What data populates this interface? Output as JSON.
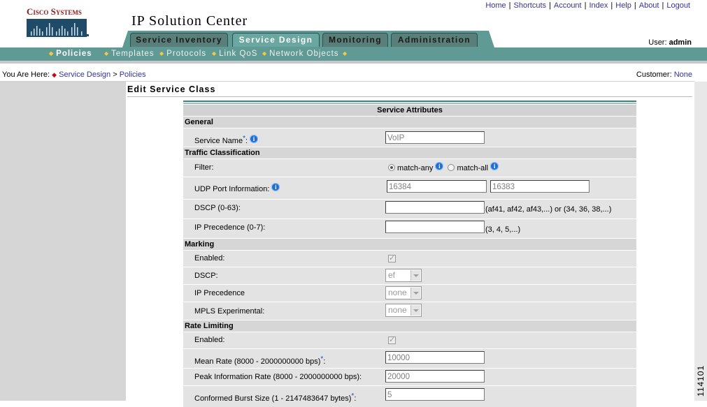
{
  "brand": {
    "logo_text": "Cisco Systems",
    "app_title": "IP Solution Center"
  },
  "top_links": [
    "Home",
    "Shortcuts",
    "Account",
    "Index",
    "Help",
    "About",
    "Logout"
  ],
  "user": {
    "label": "User:",
    "name": "admin"
  },
  "tabs": [
    {
      "label": "Service Inventory",
      "active": false
    },
    {
      "label": "Service Design",
      "active": true
    },
    {
      "label": "Monitoring",
      "active": false
    },
    {
      "label": "Administration",
      "active": false
    }
  ],
  "subnav": [
    "Policies",
    "Templates",
    "Protocols",
    "Link QoS",
    "Network Objects"
  ],
  "breadcrumb": {
    "prefix": "You Are Here:",
    "items": [
      "Service Design",
      "Policies"
    ]
  },
  "customer": {
    "label": "Customer:",
    "value": "None"
  },
  "page_title": "Edit Service Class",
  "form": {
    "title": "Service Attributes",
    "sections": {
      "general": "General",
      "traffic": "Traffic Classification",
      "marking": "Marking",
      "rate": "Rate Limiting"
    },
    "service_name": {
      "label": "Service Name",
      "value": "VoIP"
    },
    "filter": {
      "label": "Filter:",
      "option_any": "match-any",
      "option_all": "match-all",
      "selected": "match-any"
    },
    "udp": {
      "label": "UDP Port Information:",
      "value1": "16384",
      "value2": "16383"
    },
    "dscp": {
      "label": "DSCP (0-63):",
      "value": "",
      "hint": "(af41, af42, af43,...) or (34, 36, 38,...)"
    },
    "ip_prec": {
      "label": "IP Precedence (0-7):",
      "value": "",
      "hint": "(3, 4, 5,...)"
    },
    "marking_enabled": {
      "label": "Enabled:",
      "checked": true
    },
    "marking_dscp": {
      "label": "DSCP:",
      "value": "ef"
    },
    "marking_ip_prec": {
      "label": "IP Precedence",
      "value": "none"
    },
    "marking_mpls": {
      "label": "MPLS Experimental:",
      "value": "none"
    },
    "rate_enabled": {
      "label": "Enabled:",
      "checked": true
    },
    "mean_rate": {
      "label": "Mean Rate (8000  - 2000000000 bps)",
      "value": "10000"
    },
    "peak_rate": {
      "label": "Peak Information Rate (8000  - 2000000000 bps):",
      "value": "20000"
    },
    "burst": {
      "label": "Conformed Burst Size (1  - 2147483647 bytes)",
      "value": "5"
    }
  },
  "figure_number": "114101",
  "colors": {
    "teal_band": "#5f9a94",
    "tab_active": "#6aa7a1",
    "link": "#333399",
    "logo": "#8b1a1a"
  }
}
